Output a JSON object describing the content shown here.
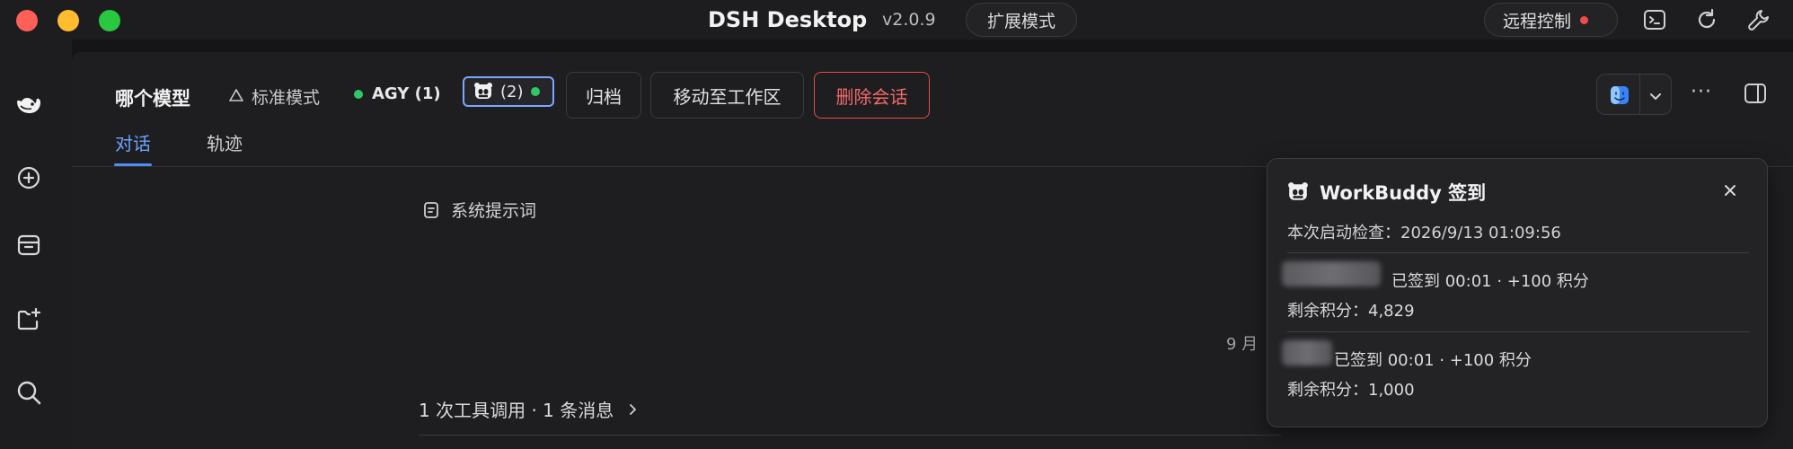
{
  "window": {
    "title": "DSH Desktop",
    "version": "v2.0.9",
    "mode_button": "扩展模式",
    "remote_button": "远程控制",
    "remote_status_color": "#f04a4a"
  },
  "toolbar_icons": [
    "terminal-icon",
    "refresh-icon",
    "wrench-icon"
  ],
  "sidebar": {
    "icons": [
      "whale-logo-icon",
      "new-chat-icon",
      "archive-icon",
      "new-folder-icon",
      "search-icon"
    ]
  },
  "session_header": {
    "model_label": "哪个模型",
    "standard_mode": "标准模式",
    "agy_label": "AGY (1)",
    "panda_count": "(2)",
    "archive_button": "归档",
    "move_button": "移动至工作区",
    "delete_button": "删除会话",
    "more_button": "···"
  },
  "tabs": [
    {
      "label": "对话",
      "active": true
    },
    {
      "label": "轨迹",
      "active": false
    }
  ],
  "content": {
    "system_prompt_label": "系统提示词",
    "date_fragment": "9 月",
    "tool_summary": "1 次工具调用 · 1 条消息"
  },
  "popup": {
    "title": "WorkBuddy 签到",
    "check_time": "本次启动检查：2026/9/13 01:09:56",
    "entries": [
      {
        "status": "已签到 00:01 · +100 积分",
        "remaining": "剩余积分：4,829"
      },
      {
        "status": "已签到 00:01 · +100 积分",
        "remaining": "剩余积分：1,000"
      }
    ]
  },
  "colors": {
    "accent": "#4f8ef7",
    "danger": "#e34b4b",
    "online": "#2ec866"
  }
}
